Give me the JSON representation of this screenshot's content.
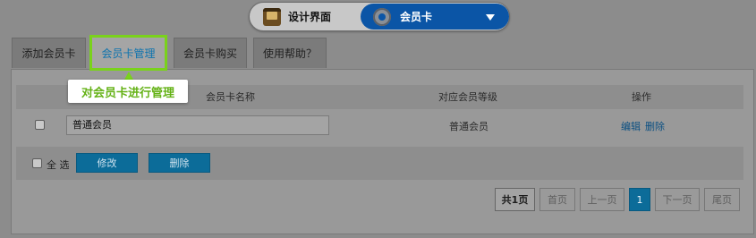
{
  "header": {
    "design_label": "设计界面",
    "member_label": "会员卡",
    "design_icon": "board-icon",
    "member_icon": "gear-icon"
  },
  "tabs": [
    {
      "label": "添加会员卡"
    },
    {
      "label": "会员卡管理",
      "active": true
    },
    {
      "label": "会员卡购买"
    },
    {
      "label": "使用帮助？"
    }
  ],
  "tooltip": {
    "text": "对会员卡进行管理"
  },
  "table": {
    "columns": [
      "会员卡名称",
      "对应会员等级",
      "操作"
    ],
    "rows": [
      {
        "name": "普通会员",
        "level": "普通会员",
        "edit": "编辑",
        "delete": "删除"
      }
    ]
  },
  "bulk": {
    "select_all": "全 选",
    "modify": "修改",
    "delete": "删除"
  },
  "pagination": {
    "total": "共1页",
    "first": "首页",
    "prev": "上一页",
    "current": "1",
    "next": "下一页",
    "last": "尾页"
  },
  "colors": {
    "highlight": "#7ad21c",
    "primary_blue": "#0b55a6",
    "button_blue": "#0c6c99"
  }
}
